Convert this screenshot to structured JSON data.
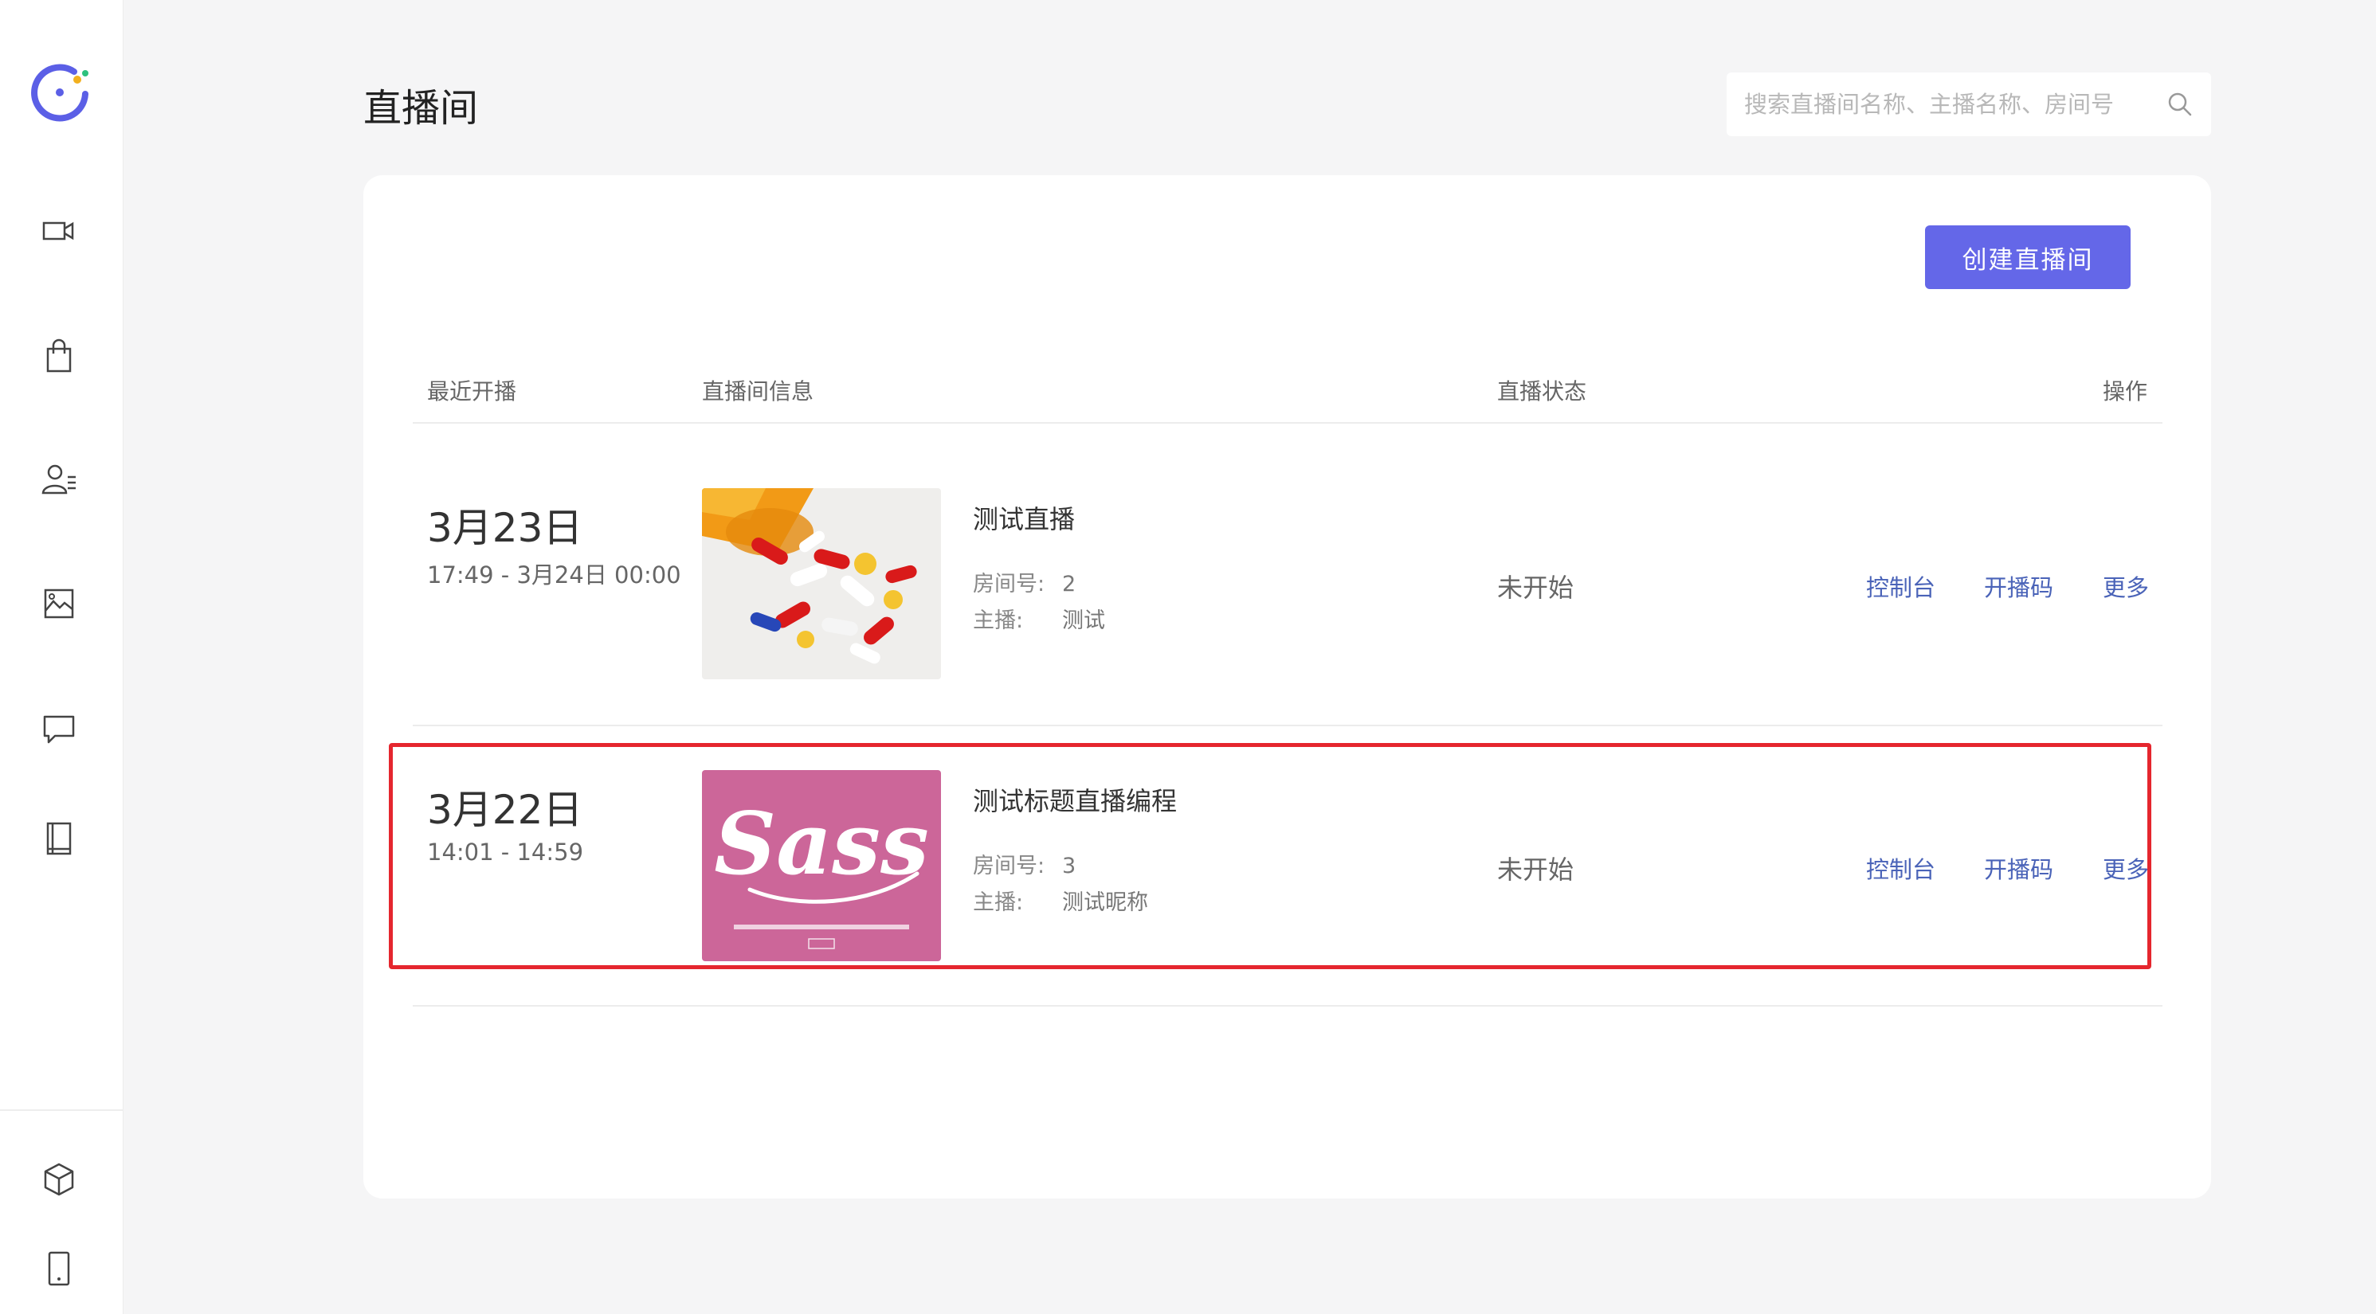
{
  "page": {
    "title": "直播间"
  },
  "search": {
    "placeholder": "搜索直播间名称、主播名称、房间号"
  },
  "sidebar": {
    "items": [
      {
        "name": "live-video",
        "icon": "video-camera-icon"
      },
      {
        "name": "products",
        "icon": "shopping-bag-icon"
      },
      {
        "name": "users",
        "icon": "user-list-icon"
      },
      {
        "name": "gallery",
        "icon": "image-chart-icon"
      },
      {
        "name": "comments",
        "icon": "chat-bubble-icon"
      },
      {
        "name": "docs",
        "icon": "book-icon"
      }
    ],
    "bottom_items": [
      {
        "name": "package",
        "icon": "cube-icon"
      },
      {
        "name": "mobile",
        "icon": "phone-icon"
      }
    ]
  },
  "toolbar": {
    "create_label": "创建直播间"
  },
  "table": {
    "headers": {
      "recent": "最近开播",
      "info": "直播间信息",
      "status": "直播状态",
      "action": "操作"
    },
    "rows": [
      {
        "date": "3月23日",
        "time": "17:49 - 3月24日 00:00",
        "thumbnail": "pills-image",
        "title": "测试直播",
        "room_label": "房间号:",
        "room_no": "2",
        "host_label": "主播:",
        "host": "测试",
        "status": "未开始",
        "actions": [
          "控制台",
          "开播码",
          "更多"
        ]
      },
      {
        "date": "3月22日",
        "time": "14:01 - 14:59",
        "thumbnail": "sass-logo-image",
        "title": "测试标题直播编程",
        "room_label": "房间号:",
        "room_no": "3",
        "host_label": "主播:",
        "host": "测试昵称",
        "status": "未开始",
        "actions": [
          "控制台",
          "开播码",
          "更多"
        ]
      }
    ]
  },
  "colors": {
    "accent": "#6467e8",
    "link": "#4a63b8",
    "highlight": "#e5262e",
    "sass_pink": "#cc6699"
  }
}
